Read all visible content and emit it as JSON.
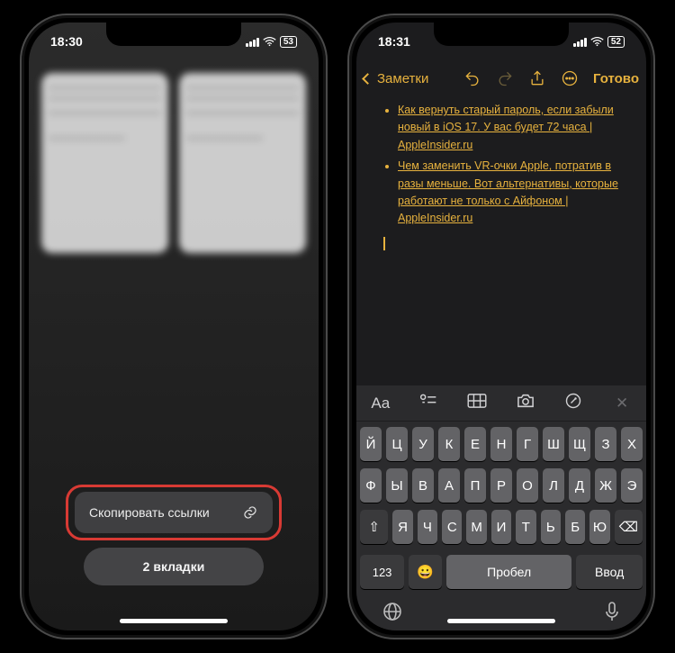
{
  "left": {
    "time": "18:30",
    "battery": "53",
    "context_menu": {
      "copy_links": "Скопировать ссылки"
    },
    "tab_count": "2 вкладки"
  },
  "right": {
    "time": "18:31",
    "battery": "52",
    "back_label": "Заметки",
    "done_label": "Готово",
    "bullets": [
      "Как вернуть старый пароль, если забыли новый в iOS 17. У вас будет 72 часа | AppleInsider.ru",
      "Чем заменить VR-очки Apple, потратив в разы меньше. Вот альтернативы, которые работают не только с Айфоном | AppleInsider.ru"
    ],
    "format_toolbar": [
      "Aa",
      "list",
      "table",
      "camera",
      "marker",
      "close"
    ],
    "keyboard": {
      "row1": [
        "Й",
        "Ц",
        "У",
        "К",
        "Е",
        "Н",
        "Г",
        "Ш",
        "Щ",
        "З",
        "Х"
      ],
      "row2": [
        "Ф",
        "Ы",
        "В",
        "А",
        "П",
        "Р",
        "О",
        "Л",
        "Д",
        "Ж",
        "Э"
      ],
      "row3_shift": "⇧",
      "row3": [
        "Я",
        "Ч",
        "С",
        "М",
        "И",
        "Т",
        "Ь",
        "Б",
        "Ю"
      ],
      "row3_del": "⌫",
      "num": "123",
      "emoji": "😀",
      "space": "Пробел",
      "enter": "Ввод"
    }
  }
}
